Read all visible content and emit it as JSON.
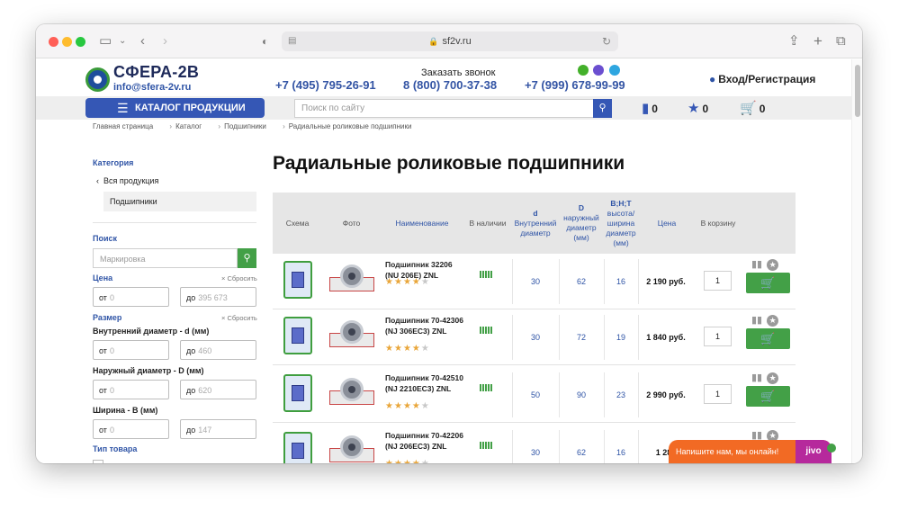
{
  "browser": {
    "url": "sf2v.ru",
    "colors": {
      "red": "#ff5f57",
      "yellow": "#febc2e",
      "green": "#28c840"
    }
  },
  "header": {
    "logo_text": "СФЕРА-2В",
    "email": "info@sfera-2v.ru",
    "phone1": "+7 (495) 795-26-91",
    "callback_label": "Заказать звонок",
    "phone2": "8 (800) 700-37-38",
    "phone3": "+7 (999) 678-99-99",
    "login": "Вход/Регистрация"
  },
  "nav": {
    "catalog_button": "КАТАЛОГ ПРОДУКЦИИ",
    "search_placeholder": "Поиск по сайту",
    "compare_count": "0",
    "favorites_count": "0",
    "cart_count": "0"
  },
  "breadcrumbs": [
    "Главная страница",
    "Каталог",
    "Подшипники",
    "Радиальные роликовые подшипники"
  ],
  "sidebar": {
    "category_title": "Категория",
    "all_products": "Вся продукция",
    "active_category": "Подшипники",
    "search_title": "Поиск",
    "search_placeholder": "Маркировка",
    "price_title": "Цена",
    "reset_label": "Сбросить",
    "price_from": "0",
    "price_to": "395 673",
    "size_title": "Размер",
    "inner_label": "Внутренний диаметр - d (мм)",
    "inner_from": "0",
    "inner_to": "460",
    "outer_label": "Наружный диаметр - D (мм)",
    "outer_from": "0",
    "outer_to": "620",
    "width_label": "Ширина - B (мм)",
    "width_from": "0",
    "width_to": "147",
    "type_title": "Тип товара",
    "from_prefix": "от",
    "to_prefix": "до"
  },
  "main": {
    "title": "Радиальные роликовые подшипники",
    "columns": {
      "schema": "Схема",
      "photo": "Фото",
      "name": "Наименование",
      "stock": "В наличии",
      "d_head": "d",
      "d_sub": "Внутренний диаметр",
      "D_head": "D",
      "D_sub": "наружный диаметр (мм)",
      "b_head": "B;H;T",
      "b_sub": "высота/ ширина диаметр (мм)",
      "price": "Цена",
      "cart": "В корзину"
    },
    "products": [
      {
        "name": "Подшипник 32206 (NU 206E) ZNL",
        "rating": 4,
        "d": "30",
        "D": "62",
        "B": "16",
        "price": "2 190 руб.",
        "qty": "1"
      },
      {
        "name": "Подшипник 70-42306 (NJ 306EC3) ZNL",
        "rating": 4,
        "d": "30",
        "D": "72",
        "B": "19",
        "price": "1 840 руб.",
        "qty": "1"
      },
      {
        "name": "Подшипник 70-42510 (NJ 2210EC3) ZNL",
        "rating": 4,
        "d": "50",
        "D": "90",
        "B": "23",
        "price": "2 990 руб.",
        "qty": "1"
      },
      {
        "name": "Подшипник 70-42206 (NJ 206EC3) ZNL",
        "rating": 4,
        "d": "30",
        "D": "62",
        "B": "16",
        "price": "1 285",
        "qty": "1"
      }
    ]
  },
  "chat": {
    "text": "Напишите нам, мы онлайн!",
    "brand": "jivo"
  }
}
